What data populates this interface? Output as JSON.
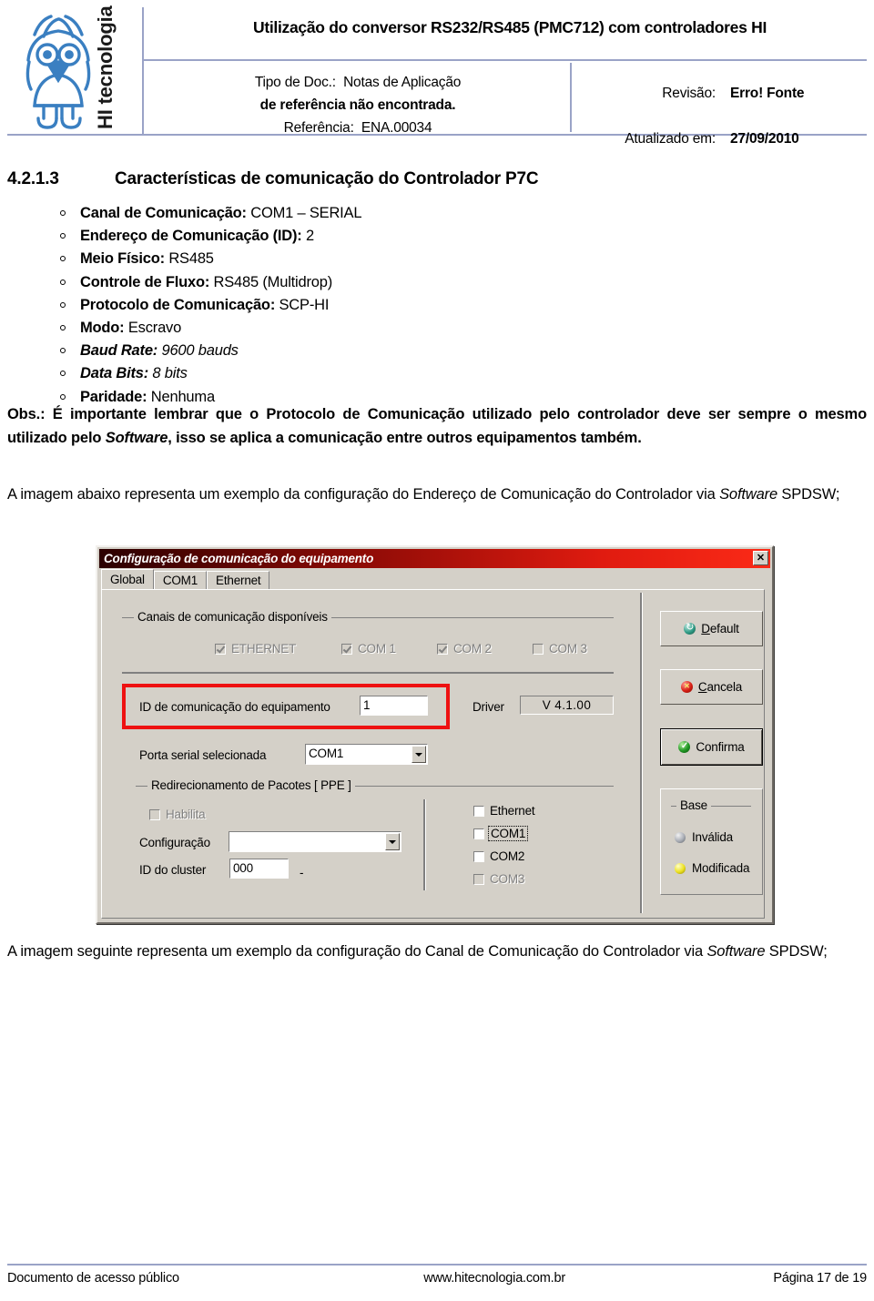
{
  "header": {
    "logo_text": "HI tecnologia",
    "logo_icon": "owl-logo-icon",
    "doc_title": "Utilização do conversor RS232/RS485 (PMC712) com controladores HI",
    "left": {
      "tipo_label": "Tipo de Doc.:",
      "tipo_value": "Notas de Aplicação",
      "error_line": "de referência não encontrada.",
      "ref_label": "Referência:",
      "ref_value": "ENA.00034"
    },
    "right": {
      "revisao_label": "Revisão:",
      "revisao_value": "Erro! Fonte",
      "atualizado_label": "Atualizado em:",
      "atualizado_value": "27/09/2010"
    }
  },
  "section": {
    "number": "4.2.1.3",
    "title": "Características de comunicação do Controlador P7C"
  },
  "bullets": [
    {
      "label": "Canal de Comunicação:",
      "value": "COM1 – SERIAL",
      "label_style": "bold",
      "value_style": "normal"
    },
    {
      "label": "Endereço de Comunicação (ID):",
      "value": "2",
      "label_style": "bold",
      "value_style": "normal"
    },
    {
      "label": "Meio Físico:",
      "value": "RS485",
      "label_style": "bold",
      "value_style": "normal"
    },
    {
      "label": "Controle de Fluxo:",
      "value": "RS485 (Multidrop)",
      "label_style": "bold",
      "value_style": "normal"
    },
    {
      "label": "Protocolo de Comunicação:",
      "value": "SCP-HI",
      "label_style": "bold",
      "value_style": "normal"
    },
    {
      "label": "Modo:",
      "value": "Escravo",
      "label_style": "bold",
      "value_style": "normal"
    },
    {
      "label": "Baud Rate:",
      "value": "9600 bauds",
      "label_style": "bold-italic",
      "value_style": "italic"
    },
    {
      "label": "Data Bits:",
      "value": "8 bits",
      "label_style": "bold-italic",
      "value_style": "italic"
    },
    {
      "label": "Paridade:",
      "value": "Nenhuma",
      "label_style": "bold",
      "value_style": "normal"
    }
  ],
  "paragraphs": {
    "obs_prefix": "Obs.:",
    "obs_text_1": " É importante lembrar que o Protocolo de Comunicação utilizado pelo controlador deve ser sempre o mesmo utilizado pelo ",
    "obs_software": "Software",
    "obs_text_2": ", isso se aplica a comunicação entre outros equipamentos também.",
    "img1_text_1": "A imagem abaixo representa um exemplo da configuração do Endereço de Comunicação do Controlador via ",
    "img1_software": "Software",
    "img1_text_2": " SPDSW;",
    "img2_text_1": "A imagem seguinte representa um exemplo da configuração do Canal de Comunicação do Controlador via ",
    "img2_software": "Software",
    "img2_text_2": " SPDSW;"
  },
  "dialog": {
    "title": "Configuração de comunicação do equipamento",
    "close_label": "✕",
    "tabs": [
      {
        "label": "Global",
        "active": true
      },
      {
        "label": "COM1",
        "active": false
      },
      {
        "label": "Ethernet",
        "active": false
      }
    ],
    "channels_group": {
      "legend": "Canais de comunicação disponíveis",
      "checkboxes": [
        {
          "label": "ETHERNET",
          "checked": true,
          "disabled": true
        },
        {
          "label": "COM 1",
          "checked": true,
          "disabled": true
        },
        {
          "label": "COM 2",
          "checked": true,
          "disabled": true
        },
        {
          "label": "COM 3",
          "checked": false,
          "disabled": true
        }
      ]
    },
    "device_id": {
      "label": "ID de comunicação do equipamento",
      "value": "1",
      "highlighted": true
    },
    "driver": {
      "label": "Driver",
      "value": "V 4.1.00"
    },
    "serial_port": {
      "label": "Porta serial selecionada",
      "value": "COM1"
    },
    "ppe_group": {
      "legend": "Redirecionamento de Pacotes [ PPE ]",
      "habilita": {
        "label": "Habilita",
        "checked": false,
        "disabled": true
      },
      "configuracao": {
        "label": "Configuração",
        "value": ""
      },
      "cluster": {
        "label": "ID do cluster",
        "value": "000",
        "suffix": "-"
      },
      "targets": [
        {
          "label": "Ethernet",
          "checked": false,
          "disabled": false,
          "focused": false
        },
        {
          "label": "COM1",
          "checked": false,
          "disabled": false,
          "focused": true
        },
        {
          "label": "COM2",
          "checked": false,
          "disabled": false,
          "focused": false
        },
        {
          "label": "COM3",
          "checked": false,
          "disabled": true,
          "focused": false
        }
      ]
    },
    "buttons": [
      {
        "label_pre": "",
        "label_underline": "D",
        "label_post": "efault",
        "icon": "refresh-icon",
        "focused": false
      },
      {
        "label_pre": "",
        "label_underline": "C",
        "label_post": "ancela",
        "icon": "cancel-icon",
        "focused": false
      },
      {
        "label_pre": "",
        "label_underline": "",
        "label_post": "Confirma",
        "icon": "confirm-icon",
        "focused": true
      }
    ],
    "base_group": {
      "legend": "Base",
      "items": [
        {
          "label": "Inválida",
          "led": "grey-led-icon"
        },
        {
          "label": "Modificada",
          "led": "yellow-led-icon"
        }
      ]
    }
  },
  "footer": {
    "left": "Documento de acesso público",
    "center": "www.hitecnologia.com.br",
    "right": "Página 17 de 19"
  },
  "colors": {
    "rule": "#9aa3c7",
    "titlebar_start": "#2b0000",
    "titlebar_end": "#fb2a17",
    "dialog_face": "#d4d0c8",
    "highlight_red": "#ee1111",
    "logo_blue": "#3a7fc1"
  }
}
